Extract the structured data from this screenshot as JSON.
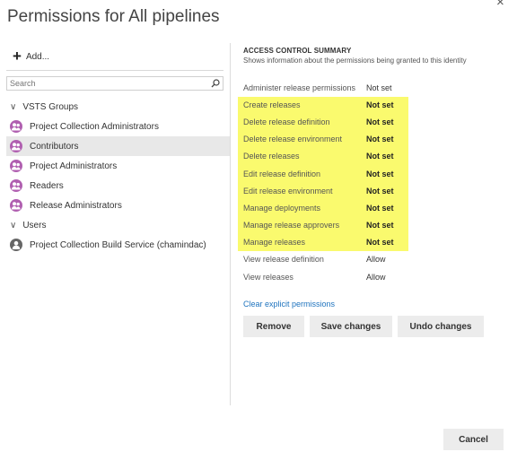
{
  "dialog": {
    "title": "Permissions for All pipelines",
    "close_glyph": "×"
  },
  "left": {
    "add_label": "Add...",
    "search_placeholder": "Search",
    "groups": [
      {
        "label": "VSTS Groups",
        "items": [
          {
            "label": "Project Collection Administrators",
            "selected": false
          },
          {
            "label": "Contributors",
            "selected": true
          },
          {
            "label": "Project Administrators",
            "selected": false
          },
          {
            "label": "Readers",
            "selected": false
          },
          {
            "label": "Release Administrators",
            "selected": false
          }
        ]
      },
      {
        "label": "Users",
        "items": [
          {
            "label": "Project Collection Build Service (chamindac)",
            "selected": false
          }
        ]
      }
    ]
  },
  "summary": {
    "heading": "ACCESS CONTROL SUMMARY",
    "subheading": "Shows information about the permissions being granted to this identity",
    "permissions": [
      {
        "name": "Administer release permissions",
        "value": "Not set"
      },
      {
        "name": "Create releases",
        "value": "Not set"
      },
      {
        "name": "Delete release definition",
        "value": "Not set"
      },
      {
        "name": "Delete release environment",
        "value": "Not set"
      },
      {
        "name": "Delete releases",
        "value": "Not set"
      },
      {
        "name": "Edit release definition",
        "value": "Not set"
      },
      {
        "name": "Edit release environment",
        "value": "Not set"
      },
      {
        "name": "Manage deployments",
        "value": "Not set"
      },
      {
        "name": "Manage release approvers",
        "value": "Not set"
      },
      {
        "name": "Manage releases",
        "value": "Not set"
      },
      {
        "name": "View release definition",
        "value": "Allow"
      },
      {
        "name": "View releases",
        "value": "Allow"
      }
    ],
    "clear_link": "Clear explicit permissions",
    "highlight_color": "#fafa6e"
  },
  "buttons": {
    "remove": "Remove",
    "save": "Save changes",
    "undo": "Undo changes",
    "cancel": "Cancel"
  },
  "colors": {
    "group_icon": "#b05fb0",
    "user_icon": "#666666",
    "link": "#1e73be"
  }
}
